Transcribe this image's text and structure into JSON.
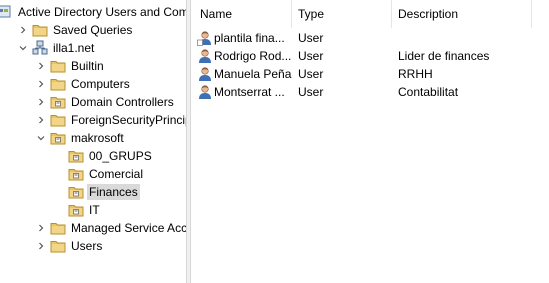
{
  "tree": {
    "root_label": "Active Directory Users and Com",
    "items": [
      {
        "label": "Saved Queries",
        "icon": "folder-icon",
        "expander": "right"
      },
      {
        "label": "illa1.net",
        "icon": "domain-icon",
        "expander": "down"
      },
      {
        "label": "Builtin",
        "icon": "folder-icon",
        "expander": "right"
      },
      {
        "label": "Computers",
        "icon": "folder-icon",
        "expander": "right"
      },
      {
        "label": "Domain Controllers",
        "icon": "ou-folder-icon",
        "expander": "right"
      },
      {
        "label": "ForeignSecurityPrincipals",
        "icon": "folder-icon",
        "expander": "right"
      },
      {
        "label": "makrosoft",
        "icon": "ou-folder-icon",
        "expander": "down"
      },
      {
        "label": "00_GRUPS",
        "icon": "ou-folder-icon",
        "expander": "none"
      },
      {
        "label": "Comercial",
        "icon": "ou-folder-icon",
        "expander": "none"
      },
      {
        "label": "Finances",
        "icon": "ou-folder-icon",
        "expander": "none",
        "selected": true
      },
      {
        "label": "IT",
        "icon": "ou-folder-icon",
        "expander": "none"
      },
      {
        "label": "Managed Service Accour",
        "icon": "folder-icon",
        "expander": "right"
      },
      {
        "label": "Users",
        "icon": "folder-icon",
        "expander": "right"
      }
    ]
  },
  "list": {
    "columns": [
      "Name",
      "Type",
      "Description"
    ],
    "rows": [
      {
        "name": "plantila fina...",
        "type": "User",
        "description": "",
        "icon": "template-user-icon"
      },
      {
        "name": "Rodrigo Rod...",
        "type": "User",
        "description": "Lider de finances",
        "icon": "user-icon"
      },
      {
        "name": "Manuela Peña",
        "type": "User",
        "description": "RRHH",
        "icon": "user-icon"
      },
      {
        "name": "Montserrat ...",
        "type": "User",
        "description": "Contabilitat",
        "icon": "user-icon"
      }
    ]
  },
  "colors": {
    "selection": "#d9d9d9",
    "folder": "#e8c46a",
    "folder_dark": "#c9a23c"
  }
}
